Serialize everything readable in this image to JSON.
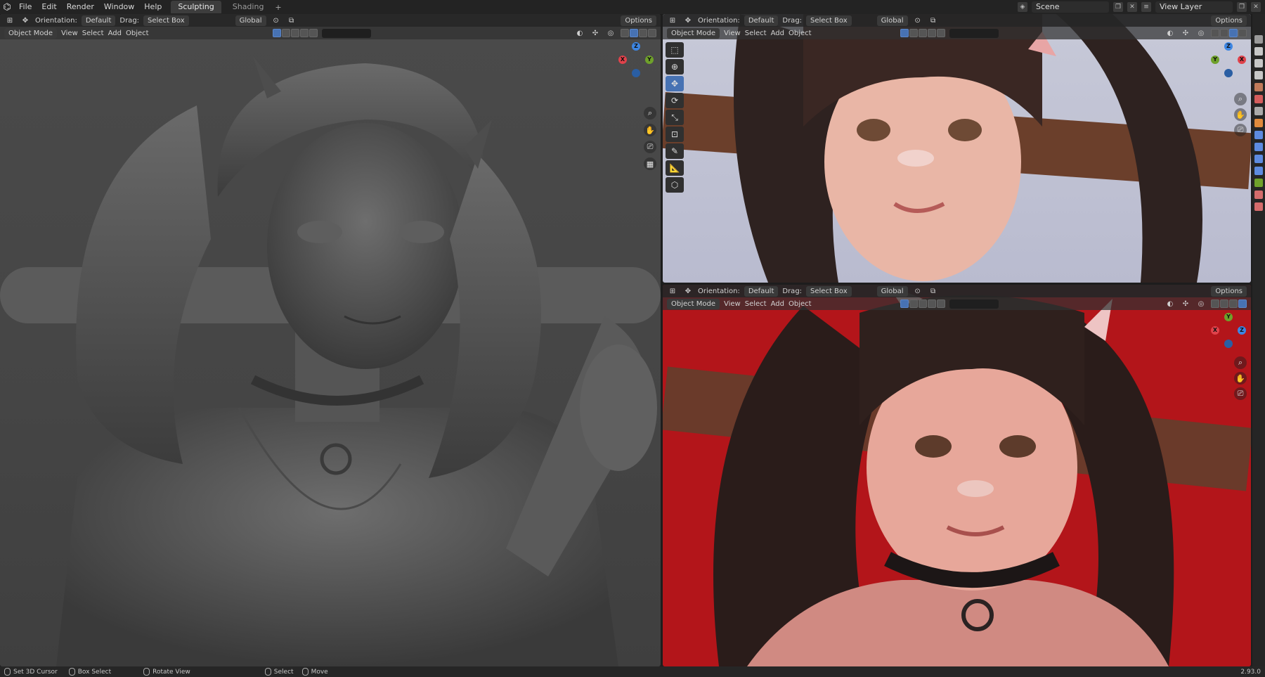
{
  "topbar": {
    "menus": [
      "File",
      "Edit",
      "Render",
      "Window",
      "Help"
    ],
    "workspaces": [
      {
        "label": "Sculpting",
        "active": true
      },
      {
        "label": "Shading",
        "active": false
      }
    ],
    "add_tab": "+",
    "scene": "Scene",
    "view_layer": "View Layer"
  },
  "viewport_header": {
    "orientation_label": "Orientation:",
    "orientation_value": "Default",
    "drag_label": "Drag:",
    "drag_value": "Select Box",
    "transform": "Global",
    "options": "Options",
    "mode": "Object Mode",
    "menus": [
      "View",
      "Select",
      "Add",
      "Object"
    ]
  },
  "statusbar": {
    "items": [
      "Set 3D Cursor",
      "Box Select",
      "Rotate View",
      "Select",
      "Move"
    ],
    "version": "2.93.0"
  },
  "colors": {
    "accent": "#4772b3",
    "axis_x": "#e0424b",
    "axis_y": "#6fa12b",
    "axis_z": "#3d86e3"
  },
  "icons": [
    "blender-logo-icon",
    "move-icon",
    "cursor-icon",
    "rotate-icon",
    "scale-icon",
    "transform-icon",
    "annotate-icon",
    "measure-icon",
    "add-cube-icon",
    "zoom-icon",
    "hand-icon",
    "camera-icon",
    "grid-icon"
  ]
}
